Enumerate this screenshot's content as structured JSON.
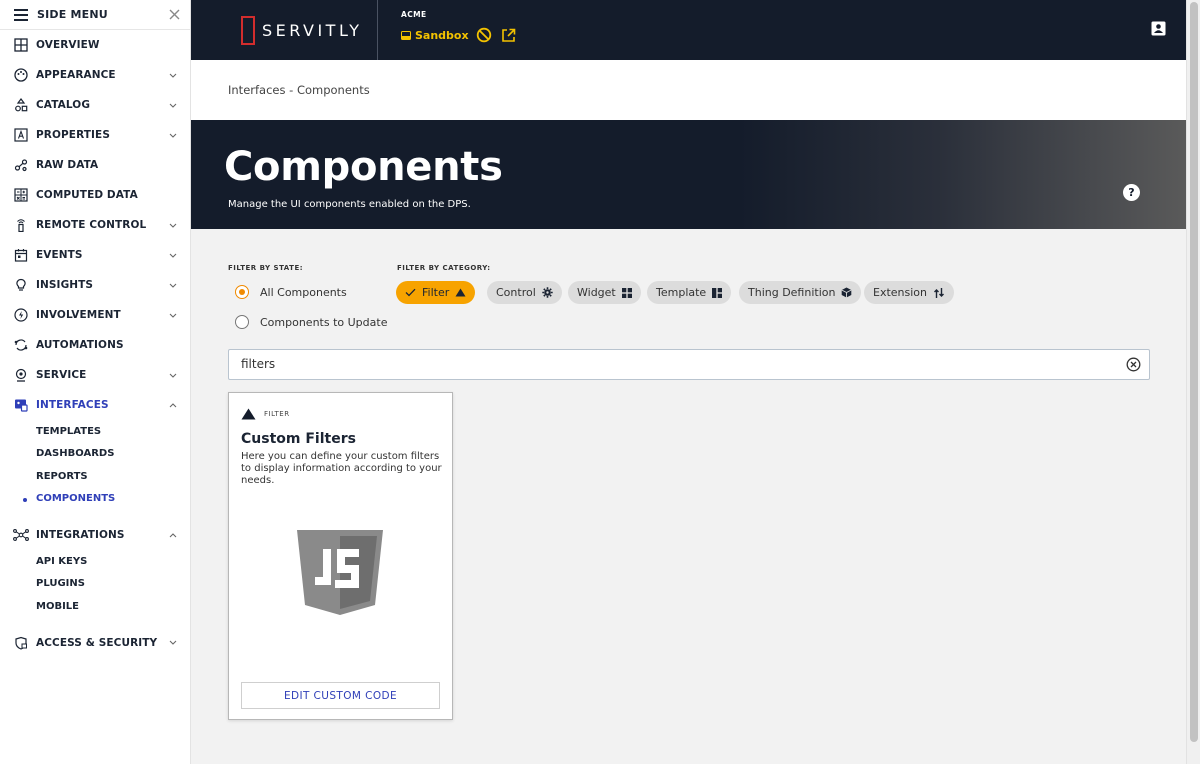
{
  "sidebar": {
    "title": "SIDE MENU",
    "items": [
      {
        "label": "OVERVIEW"
      },
      {
        "label": "APPEARANCE"
      },
      {
        "label": "CATALOG"
      },
      {
        "label": "PROPERTIES"
      },
      {
        "label": "RAW DATA"
      },
      {
        "label": "COMPUTED DATA"
      },
      {
        "label": "REMOTE CONTROL"
      },
      {
        "label": "EVENTS"
      },
      {
        "label": "INSIGHTS"
      },
      {
        "label": "INVOLVEMENT"
      },
      {
        "label": "AUTOMATIONS"
      },
      {
        "label": "SERVICE"
      },
      {
        "label": "INTERFACES"
      },
      {
        "label": "INTEGRATIONS"
      },
      {
        "label": "ACCESS & SECURITY"
      }
    ],
    "interfaces_sub": [
      "TEMPLATES",
      "DASHBOARDS",
      "REPORTS",
      "COMPONENTS"
    ],
    "integrations_sub": [
      "API KEYS",
      "PLUGINS",
      "MOBILE"
    ]
  },
  "topbar": {
    "brand": "SERVITLY",
    "org": "ACME",
    "environment": "Sandbox"
  },
  "breadcrumb": "Interfaces - Components",
  "hero": {
    "title": "Components",
    "subtitle": "Manage the UI components enabled on the DPS.",
    "help": "?"
  },
  "filters": {
    "state_label": "FILTER BY STATE:",
    "category_label": "FILTER BY CATEGORY:",
    "states": [
      "All Components",
      "Components to Update"
    ],
    "selected_state": "All Components",
    "categories": [
      "Filter",
      "Control",
      "Widget",
      "Template",
      "Thing Definition",
      "Extension"
    ],
    "selected_category": "Filter"
  },
  "search": {
    "value": "filters"
  },
  "card": {
    "category": "FILTER",
    "title": "Custom Filters",
    "description": "Here you can define your custom filters to display information according to your needs.",
    "button": "EDIT CUSTOM CODE"
  },
  "colors": {
    "navy": "#141c2b",
    "accent_blue": "#2f3fb8",
    "accent_orange": "#f7a300",
    "sandbox_yellow": "#f3c200",
    "logo_red": "#d22d2d"
  }
}
